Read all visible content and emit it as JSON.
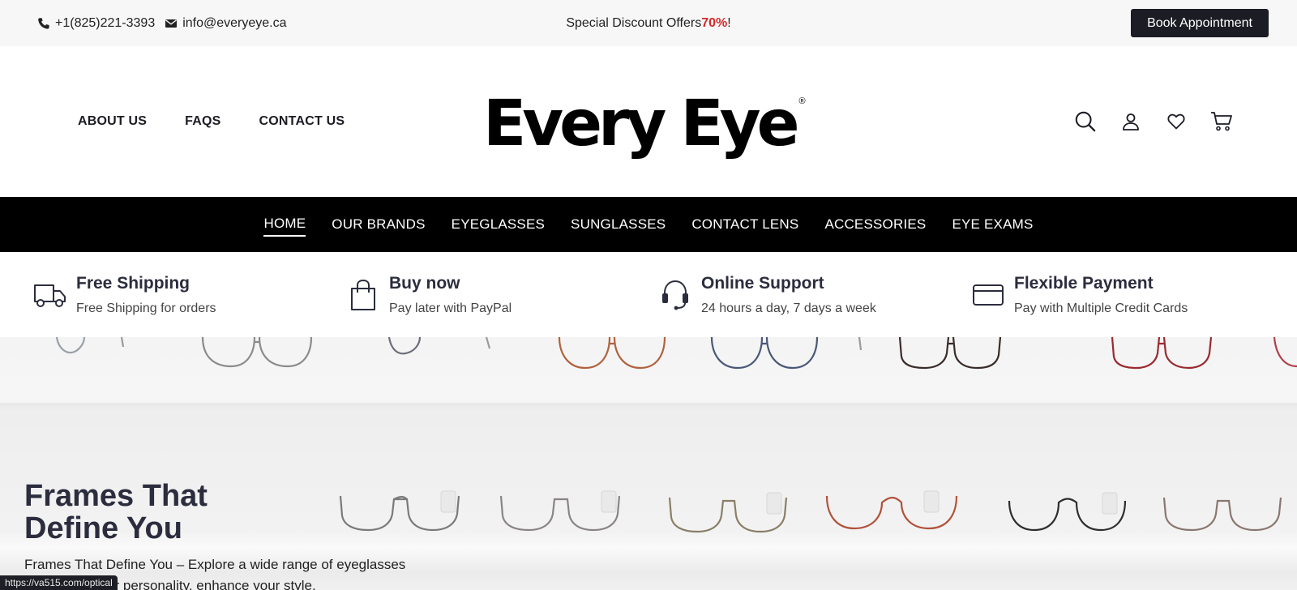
{
  "topbar": {
    "phone": "+1(825)221-3393",
    "email": "info@everyeye.ca",
    "offer_prefix": "Special Discount Offers ",
    "offer_percent": "70%",
    "offer_suffix": "!",
    "book_label": "Book Appointment"
  },
  "header": {
    "links": [
      "ABOUT US",
      "FAQS",
      "CONTACT US"
    ],
    "logo": "Every Eye",
    "logo_mark": "®"
  },
  "mainnav": {
    "items": [
      "HOME",
      "OUR BRANDS",
      "EYEGLASSES",
      "SUNGLASSES",
      "CONTACT LENS",
      "ACCESSORIES",
      "EYE EXAMS"
    ],
    "active": "HOME"
  },
  "features": [
    {
      "icon": "truck-icon",
      "title": "Free Shipping",
      "subtitle": "Free Shipping for orders"
    },
    {
      "icon": "shopping-bag-icon",
      "title": "Buy now",
      "subtitle": "Pay later with PayPal"
    },
    {
      "icon": "headset-icon",
      "title": "Online Support",
      "subtitle": "24 hours a day, 7 days a week"
    },
    {
      "icon": "credit-card-icon",
      "title": "Flexible Payment",
      "subtitle": "Pay with Multiple Credit Cards"
    }
  ],
  "hero": {
    "title_line1": "Frames That",
    "title_line2": "Define You",
    "description_line1": "Frames That Define You – Explore a wide range of eyeglasses",
    "description_line2": "that match your personality, enhance your style,"
  },
  "status_url": "https://va515.com/optical",
  "colors": {
    "accent": "#d12a2a",
    "dark": "#1b1c24",
    "nav_bg": "#000000",
    "heading": "#2b2d3e"
  }
}
